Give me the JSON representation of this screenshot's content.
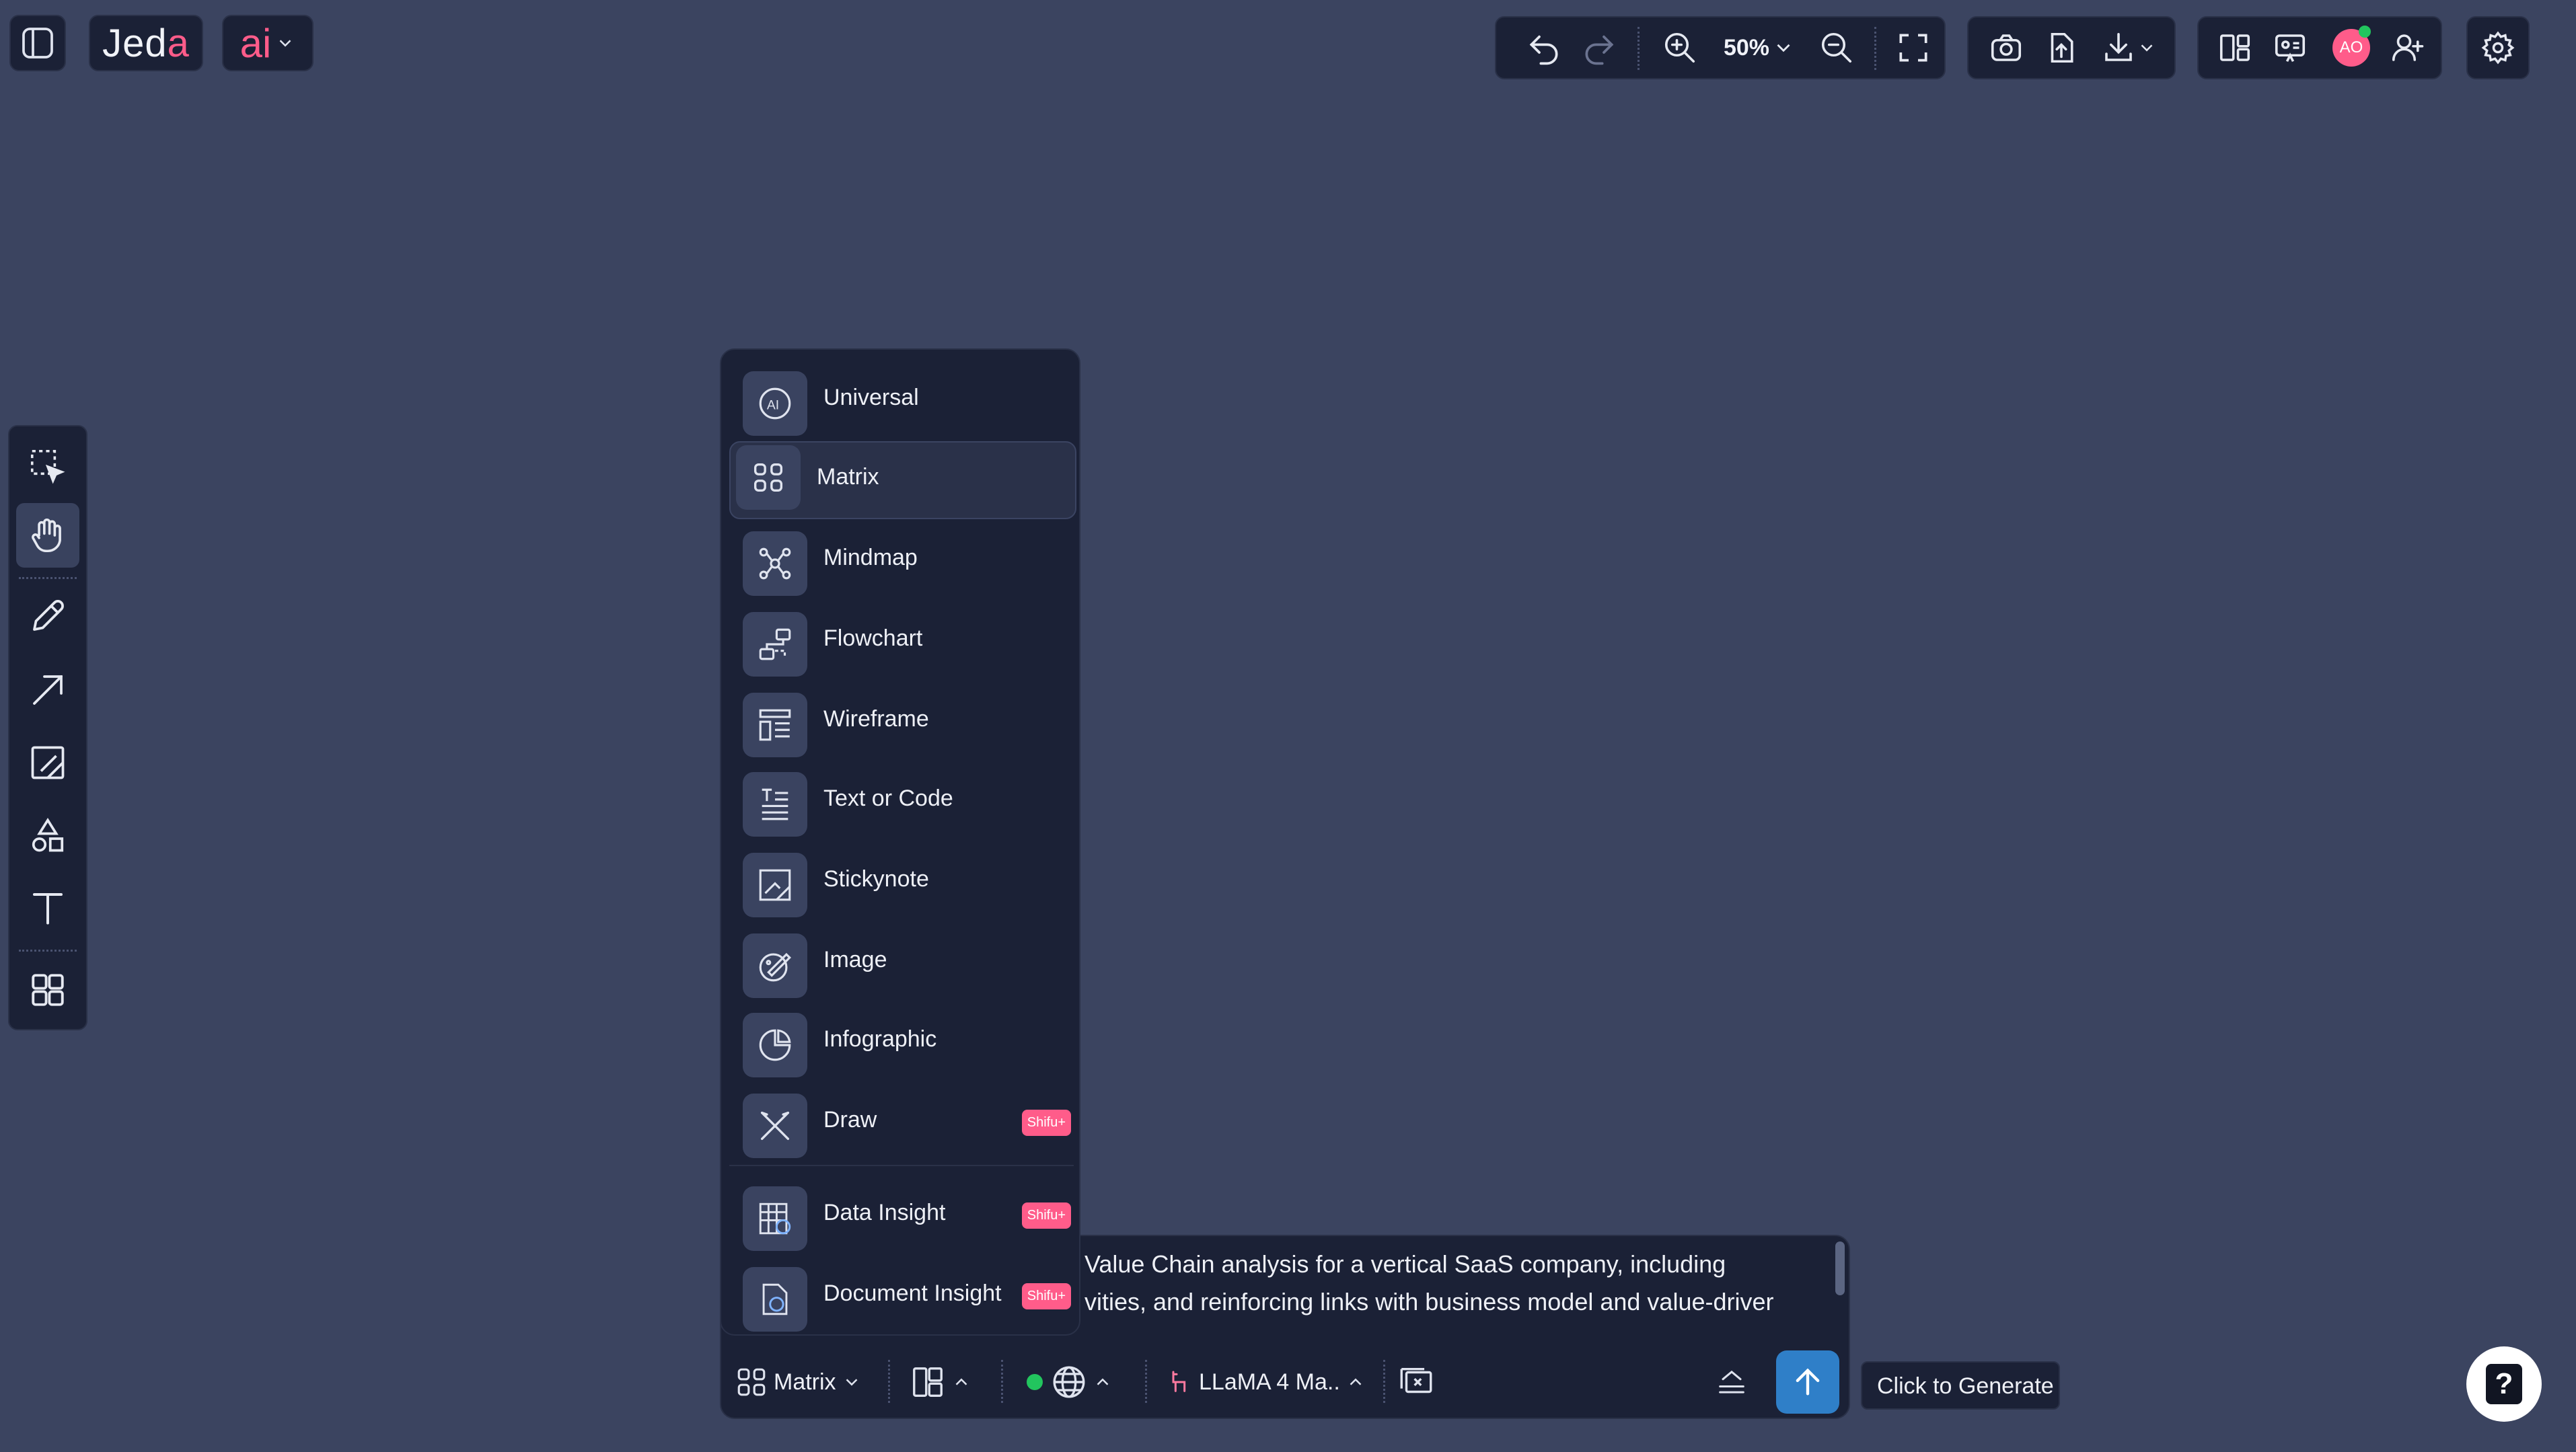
{
  "app": {
    "logo_text": "Jed",
    "logo_accent": "a",
    "ai_menu_label": "ai"
  },
  "toolbar": {
    "zoom_level": "50%",
    "undo_icon": "undo-icon",
    "redo_icon": "redo-icon",
    "zoom_in_icon": "zoom-in-icon",
    "zoom_out_icon": "zoom-out-icon",
    "fit_icon": "fullscreen-icon",
    "screenshot_icon": "camera-icon",
    "upload_icon": "upload-icon",
    "download_icon": "download-icon",
    "layout_icon": "layout-icon",
    "present_icon": "present-icon",
    "avatar_initials": "AO",
    "invite_icon": "add-user-icon",
    "settings_icon": "gear-icon"
  },
  "tools": [
    {
      "name": "select",
      "icon": "select-icon"
    },
    {
      "name": "hand",
      "icon": "hand-icon",
      "active": true
    },
    {
      "name": "pencil",
      "icon": "pencil-icon"
    },
    {
      "name": "arrow",
      "icon": "arrow-icon"
    },
    {
      "name": "stickynote",
      "icon": "stickynote-icon"
    },
    {
      "name": "shapes",
      "icon": "shapes-icon"
    },
    {
      "name": "text",
      "icon": "text-icon"
    },
    {
      "name": "components",
      "icon": "grid-icon"
    }
  ],
  "menu": {
    "items": [
      {
        "label": "Universal",
        "icon": "ai-icon"
      },
      {
        "label": "Matrix",
        "icon": "matrix-icon",
        "selected": true
      },
      {
        "label": "Mindmap",
        "icon": "mindmap-icon"
      },
      {
        "label": "Flowchart",
        "icon": "flowchart-icon"
      },
      {
        "label": "Wireframe",
        "icon": "wireframe-icon"
      },
      {
        "label": "Text or Code",
        "icon": "text-code-icon"
      },
      {
        "label": "Stickynote",
        "icon": "stickynote-icon"
      },
      {
        "label": "Image",
        "icon": "image-icon"
      },
      {
        "label": "Infographic",
        "icon": "infographic-icon"
      },
      {
        "label": "Draw",
        "icon": "draw-icon",
        "badge": "Shifu+"
      },
      {
        "label": "Data Insight",
        "icon": "data-insight-icon",
        "badge": "Shifu+"
      },
      {
        "label": "Document Insight",
        "icon": "document-insight-icon",
        "badge": "Shifu+"
      }
    ]
  },
  "prompt": {
    "line1": "Value Chain analysis for a vertical SaaS company, including",
    "line2": "vities, and reinforcing links with business model and value-driver"
  },
  "bottom_bar": {
    "type_label": "Matrix",
    "model_label": "LLaMA 4 Ma..",
    "status_color": "#22c55e",
    "generate_tooltip": "Click to Generate",
    "help_label": "?"
  },
  "colors": {
    "background": "#3b4460",
    "panel": "#1b2136",
    "accent_pink": "#ff5c8a",
    "accent_blue": "#2f7fc8"
  }
}
